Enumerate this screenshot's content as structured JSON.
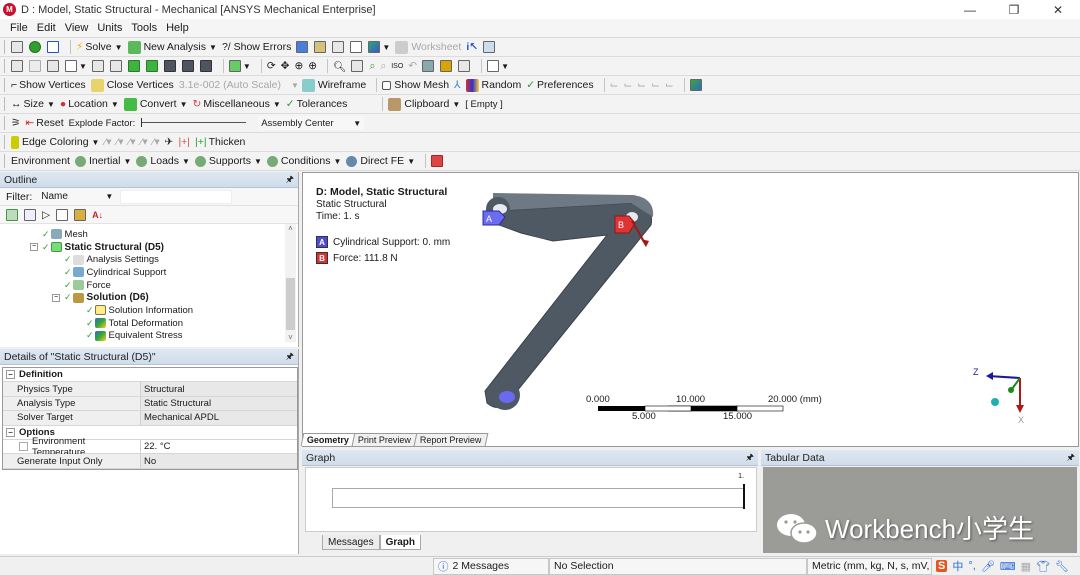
{
  "window": {
    "title": "D : Model, Static Structural - Mechanical [ANSYS Mechanical Enterprise]",
    "app_icon_letter": "M",
    "controls": {
      "minimize": "—",
      "restore": "❐",
      "close": "✕"
    }
  },
  "menu": [
    "File",
    "Edit",
    "View",
    "Units",
    "Tools",
    "Help"
  ],
  "toolbar1": {
    "solve": "Solve",
    "new_analysis": "New Analysis",
    "show_errors": "?/ Show Errors",
    "worksheet": "Worksheet"
  },
  "toolbar3": {
    "show_vertices": "Show Vertices",
    "close_vertices": "Close Vertices",
    "auto_scale": "3.1e-002 (Auto Scale)",
    "wireframe": "Wireframe",
    "show_mesh": "Show Mesh",
    "random": "Random",
    "preferences": "Preferences"
  },
  "toolbar4": {
    "size": "Size",
    "location": "Location",
    "convert": "Convert",
    "miscellaneous": "Miscellaneous",
    "tolerances": "Tolerances",
    "clipboard": "Clipboard",
    "clipboard_state": "[ Empty ]"
  },
  "toolbar5": {
    "reset": "Reset",
    "explode_factor": "Explode Factor:",
    "explode_slider_value": 0,
    "assembly_center": "Assembly Center"
  },
  "toolbar6": {
    "edge_coloring": "Edge Coloring",
    "thicken": "Thicken"
  },
  "toolbar7": {
    "environment": "Environment",
    "inertial": "Inertial",
    "loads": "Loads",
    "supports": "Supports",
    "conditions": "Conditions",
    "direct_fe": "Direct FE"
  },
  "outline": {
    "title": "Outline",
    "filter_label": "Filter:",
    "filter_value": "Name",
    "filter_text": "",
    "tree": [
      {
        "label": "Mesh",
        "level": 1,
        "bold": false,
        "icon": "mesh-icon"
      },
      {
        "label": "Static Structural (D5)",
        "level": 1,
        "bold": true,
        "icon": "static-structural-icon",
        "expanded": true
      },
      {
        "label": "Analysis Settings",
        "level": 2,
        "bold": false,
        "icon": "analysis-settings-icon"
      },
      {
        "label": "Cylindrical Support",
        "level": 2,
        "bold": false,
        "icon": "cylindrical-support-icon"
      },
      {
        "label": "Force",
        "level": 2,
        "bold": false,
        "icon": "force-icon"
      },
      {
        "label": "Solution (D6)",
        "level": 2,
        "bold": true,
        "icon": "solution-icon",
        "expanded": true
      },
      {
        "label": "Solution Information",
        "level": 3,
        "bold": false,
        "icon": "solution-information-icon"
      },
      {
        "label": "Total Deformation",
        "level": 3,
        "bold": false,
        "icon": "total-deformation-icon"
      },
      {
        "label": "Equivalent Stress",
        "level": 3,
        "bold": false,
        "icon": "equivalent-stress-icon"
      }
    ]
  },
  "details": {
    "title": "Details of \"Static Structural (D5)\"",
    "groups": [
      {
        "name": "Definition",
        "rows": [
          {
            "label": "Physics Type",
            "value": "Structural"
          },
          {
            "label": "Analysis Type",
            "value": "Static Structural"
          },
          {
            "label": "Solver Target",
            "value": "Mechanical APDL"
          }
        ]
      },
      {
        "name": "Options",
        "rows": [
          {
            "label": "Environment Temperature",
            "value": "22. °C",
            "checkbox": true
          },
          {
            "label": "Generate Input Only",
            "value": "No"
          }
        ]
      }
    ]
  },
  "viewport": {
    "title": "D: Model, Static Structural",
    "subtitle": "Static Structural",
    "time": "Time: 1. s",
    "legend": [
      {
        "tag": "A",
        "label": "Cylindrical Support: 0. mm",
        "color": "#5555e0"
      },
      {
        "tag": "B",
        "label": "Force: 111.8 N",
        "color": "#e03434"
      }
    ],
    "scale": {
      "top": [
        "0.000",
        "10.000",
        "20.000 (mm)"
      ],
      "bottom": [
        "5.000",
        "15.000"
      ]
    },
    "triad": {
      "z": "Z",
      "x": "X"
    },
    "part_color": "#4e5863"
  },
  "view_tabs": [
    "Geometry",
    "Print Preview",
    "Report Preview"
  ],
  "graph": {
    "title": "Graph",
    "time_marker_label": "1.",
    "tabs": [
      "Messages",
      "Graph"
    ]
  },
  "tabular": {
    "title": "Tabular Data",
    "watermark": "Workbench小学生"
  },
  "statusbar": {
    "messages": "2 Messages",
    "selection": "No Selection",
    "units": "Metric (mm, kg, N, s, mV, m"
  }
}
